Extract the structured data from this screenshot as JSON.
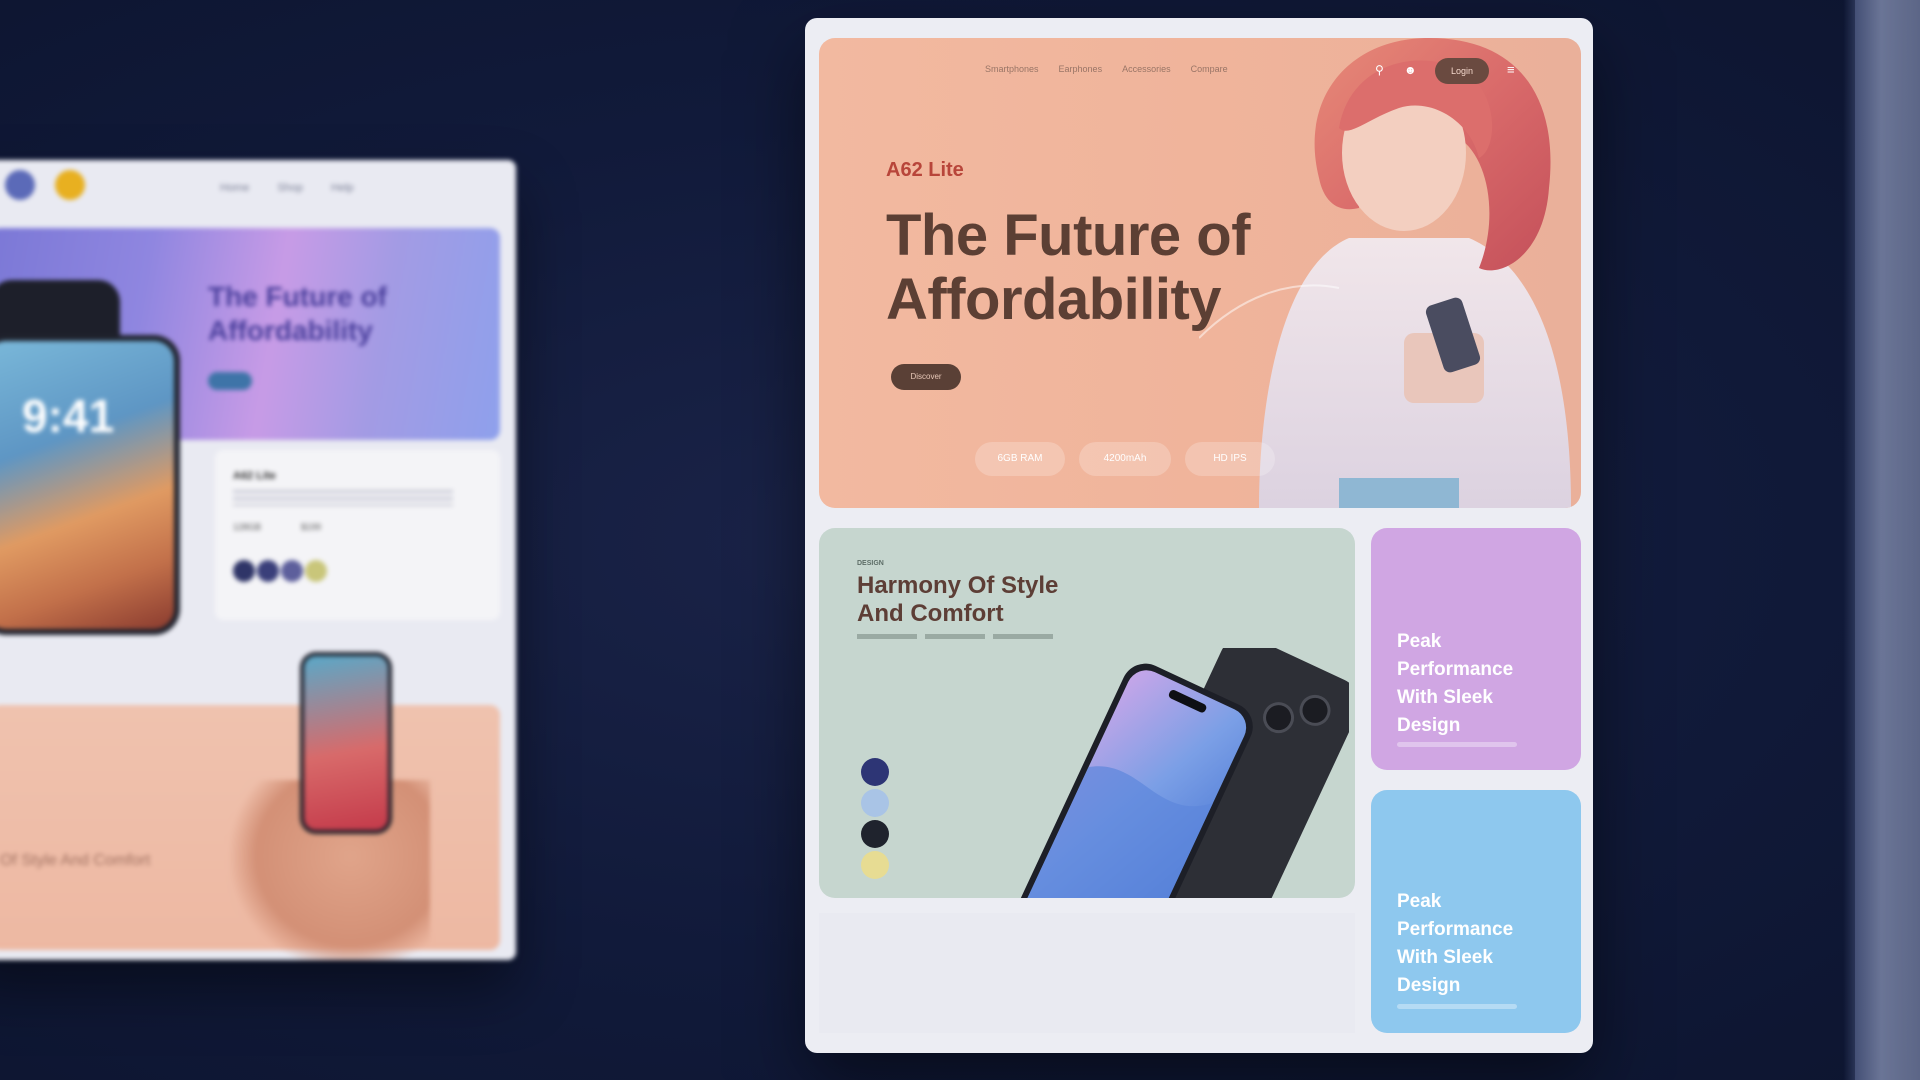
{
  "background": {
    "color": "#131c3e"
  },
  "left_mockup": {
    "nav_links": [
      "Home",
      "Shop",
      "Help"
    ],
    "hero_title": "The Future of Affordability",
    "phone_time": "9:41",
    "card_title": "A62 Lite",
    "card_stats": [
      "128GB",
      "$199"
    ],
    "swatch_colors": [
      "#2f3568",
      "#3a3f7a",
      "#5d5f9c",
      "#c9c67a"
    ],
    "bottom_title": "Of Style And Comfort"
  },
  "main_mockup": {
    "nav": {
      "logo": "",
      "links": [
        "Smartphones",
        "Earphones",
        "Accessories",
        "Compare"
      ],
      "login_label": "Login"
    },
    "hero": {
      "model": "A62 Lite",
      "title_line1": "The Future of",
      "title_line2": "Affordability",
      "button_label": "Discover",
      "chips": [
        "6GB RAM",
        "4200mAh",
        "HD IPS"
      ]
    },
    "style_card": {
      "eyebrow": "DESIGN",
      "title_line1": "Harmony Of Style",
      "title_line2": "And Comfort",
      "color_options": [
        "#2d3575",
        "#a9c4e6",
        "#1f232d",
        "#e7dc93"
      ]
    },
    "performance_cards": [
      {
        "line1": "Peak",
        "line2": "Performance",
        "line3": "With Sleek",
        "line4": "Design",
        "color": "#d0a6e3"
      },
      {
        "line1": "Peak",
        "line2": "Performance",
        "line3": "With Sleek",
        "line4": "Design",
        "color": "#8ec8ee"
      }
    ]
  }
}
